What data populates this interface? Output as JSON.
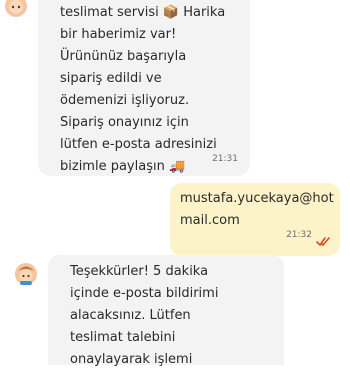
{
  "messages": [
    {
      "sender": "bot",
      "lines": [
        "teslimat servisi 📦 Harika",
        "bir haberimiz var!",
        "Ürününüz başarıyla",
        "sipariş edildi ve",
        "ödemenizi işliyoruz.",
        "Sipariş onayınız için",
        "lütfen e-posta adresinizi",
        "bizimle paylaşın 🚚"
      ],
      "time": "21:31"
    },
    {
      "sender": "user",
      "lines": [
        "mustafa.yucekaya@hot",
        "mail.com"
      ],
      "time": "21:32",
      "status_icon": "double-check-icon"
    },
    {
      "sender": "bot",
      "lines": [
        "Teşekkürler! 5 dakika",
        "içinde e-posta bildirimi",
        "alacaksınız. Lütfen",
        "teslimat talebini",
        "onaylayarak işlemi"
      ]
    }
  ],
  "colors": {
    "bot_bubble": "#f3f3f3",
    "user_bubble": "#fdf3c8",
    "check": "#d94a1e"
  }
}
